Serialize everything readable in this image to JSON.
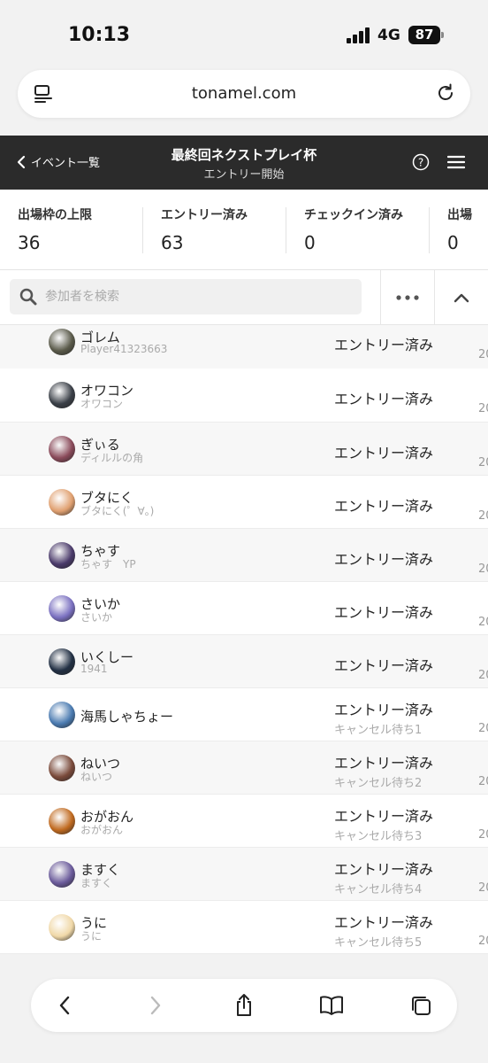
{
  "status_bar": {
    "time": "10:13",
    "network": "4G",
    "battery": "87"
  },
  "browser": {
    "url": "tonamel.com"
  },
  "header": {
    "back_label": "イベント一覧",
    "title": "最終回ネクストプレイ杯",
    "subtitle": "エントリー開始"
  },
  "stats": [
    {
      "label": "出場枠の上限",
      "value": "36"
    },
    {
      "label": "エントリー済み",
      "value": "63"
    },
    {
      "label": "チェックイン済み",
      "value": "0"
    },
    {
      "label": "出場",
      "value": "0"
    }
  ],
  "search": {
    "placeholder": "参加者を検索"
  },
  "participants": [
    {
      "name": "ゴレム",
      "sub": "Player41323663",
      "status": "エントリー済み",
      "cancel": "",
      "year": "20",
      "avatar_color": "#5a5a4a"
    },
    {
      "name": "オワコン",
      "sub": "オワコン",
      "status": "エントリー済み",
      "cancel": "",
      "year": "20",
      "avatar_color": "#3a3f47"
    },
    {
      "name": "ぎぃる",
      "sub": "ディルルの角",
      "status": "エントリー済み",
      "cancel": "",
      "year": "20",
      "avatar_color": "#8a4a5a"
    },
    {
      "name": "ブタにく",
      "sub": "ブタにく(゜∀。)",
      "status": "エントリー済み",
      "cancel": "",
      "year": "20",
      "avatar_color": "#e0a070"
    },
    {
      "name": "ちゃす",
      "sub": "ちゃす　YP",
      "status": "エントリー済み",
      "cancel": "",
      "year": "20",
      "avatar_color": "#4a3a6a"
    },
    {
      "name": "さいか",
      "sub": "さいか",
      "status": "エントリー済み",
      "cancel": "",
      "year": "20",
      "avatar_color": "#7a70c0"
    },
    {
      "name": "いくしー",
      "sub": "1941",
      "status": "エントリー済み",
      "cancel": "",
      "year": "20",
      "avatar_color": "#223044"
    },
    {
      "name": "海馬しゃちょー",
      "sub": "",
      "status": "エントリー済み",
      "cancel": "キャンセル待ち1",
      "year": "20",
      "avatar_color": "#4a7ab0"
    },
    {
      "name": "ねいつ",
      "sub": "ねいつ",
      "status": "エントリー済み",
      "cancel": "キャンセル待ち2",
      "year": "20",
      "avatar_color": "#7a4a3a"
    },
    {
      "name": "おがおん",
      "sub": "おがおん",
      "status": "エントリー済み",
      "cancel": "キャンセル待ち3",
      "year": "20",
      "avatar_color": "#c06a20"
    },
    {
      "name": "ますく",
      "sub": "ますく",
      "status": "エントリー済み",
      "cancel": "キャンセル待ち4",
      "year": "20",
      "avatar_color": "#6a5a9a"
    },
    {
      "name": "うに",
      "sub": "うに",
      "status": "エントリー済み",
      "cancel": "キャンセル待ち5",
      "year": "20",
      "avatar_color": "#f0d8a8"
    }
  ],
  "icons": {
    "reader": "reader-icon",
    "reload": "reload-icon",
    "back": "chevron-left-icon",
    "help": "help-icon",
    "menu": "hamburger-icon",
    "search": "search-icon",
    "more": "more-icon",
    "collapse": "chevron-up-icon",
    "forward": "chevron-right-icon",
    "share": "share-icon",
    "bookmarks": "book-icon",
    "tabs": "tabs-icon"
  },
  "colors": {
    "header_bg": "#2b2b2b",
    "row_alt": "#f7f7f7",
    "muted": "#aaaaaa"
  }
}
